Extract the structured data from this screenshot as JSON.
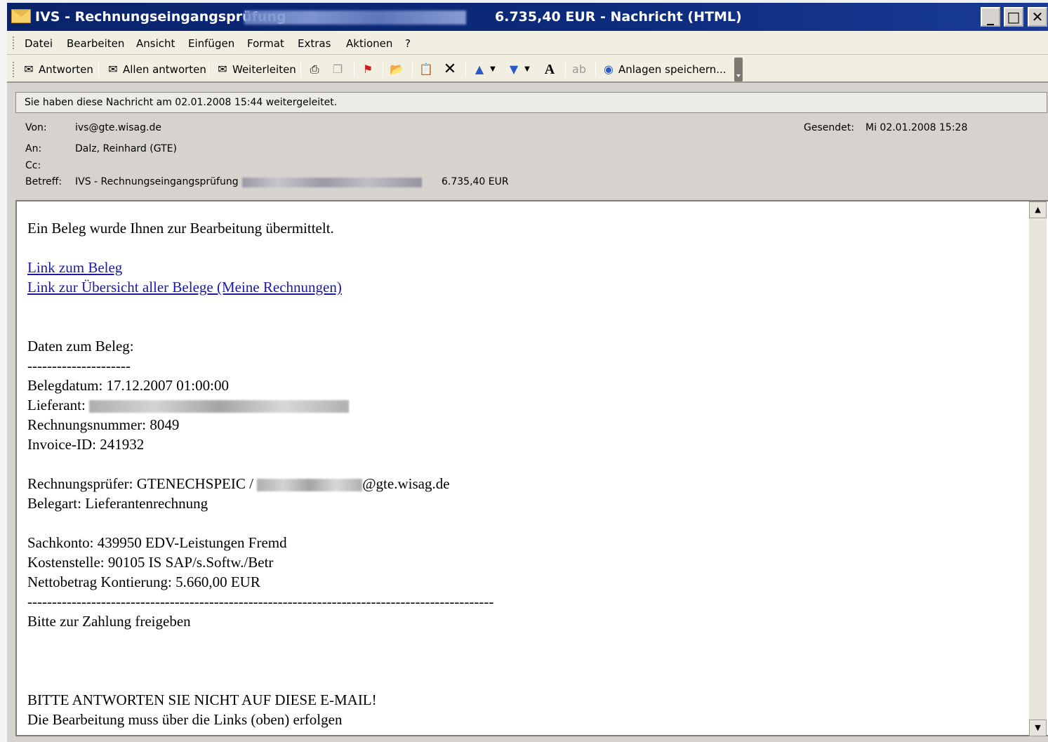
{
  "window": {
    "title_prefix": "IVS - Rechnungseingangsprüfung",
    "title_suffix": "6.735,40 EUR - Nachricht (HTML)",
    "minimize_label": "_",
    "maximize_label": "□",
    "close_label": "✕"
  },
  "menu": {
    "items": [
      "Datei",
      "Bearbeiten",
      "Ansicht",
      "Einfügen",
      "Format",
      "Extras",
      "Aktionen",
      "?"
    ]
  },
  "toolbar": {
    "reply_label": "Antworten",
    "reply_all_label": "Allen antworten",
    "forward_label": "Weiterleiten",
    "save_attachments_label": "Anlagen speichern..."
  },
  "infobar": {
    "text": "Sie haben diese Nachricht am 02.01.2008 15:44 weitergeleitet."
  },
  "header": {
    "from_label": "Von:",
    "from_value": "ivs@gte.wisag.de",
    "sent_label": "Gesendet:",
    "sent_value": "Mi 02.01.2008 15:28",
    "to_label": "An:",
    "to_value": "Dalz, Reinhard (GTE)",
    "cc_label": "Cc:",
    "subject_label": "Betreff:",
    "subject_prefix": "IVS - Rechnungseingangsprüfung",
    "subject_amount": "6.735,40 EUR"
  },
  "message": {
    "intro": "Ein Beleg wurde Ihnen zur Bearbeitung übermittelt.",
    "link_beleg": "Link zum Beleg",
    "link_overview": "Link zur Übersicht aller Belege (Meine Rechnungen)",
    "data_heading": "Daten zum Beleg:",
    "separator_short": "---------------------",
    "belegdatum": "Belegdatum: 17.12.2007 01:00:00",
    "lieferant_label": "Lieferant:",
    "rechnungsnummer": "Rechnungsnummer: 8049",
    "invoice_id": "Invoice-ID: 241932",
    "pruefer_prefix": "Rechnungsprüfer: GTENECHSPEIC /",
    "pruefer_domain": "@gte.wisag.de",
    "belegart": "Belegart: Lieferantenrechnung",
    "sachkonto": "Sachkonto: 439950 EDV-Leistungen Fremd",
    "kostenstelle": "Kostenstelle: 90105 IS SAP/s.Softw./Betr",
    "nettobetrag": "Nettobetrag Kontierung: 5.660,00 EUR",
    "separator_long": "-----------------------------------------------------------------------------------------------",
    "freigabe": "Bitte zur Zahlung freigeben",
    "warning": "BITTE ANTWORTEN SIE NICHT AUF DIESE E-MAIL!",
    "hint": "Die Bearbeitung muss über die Links (oben) erfolgen"
  },
  "scrollbar": {
    "up_arrow": "▲",
    "down_arrow": "▼"
  }
}
